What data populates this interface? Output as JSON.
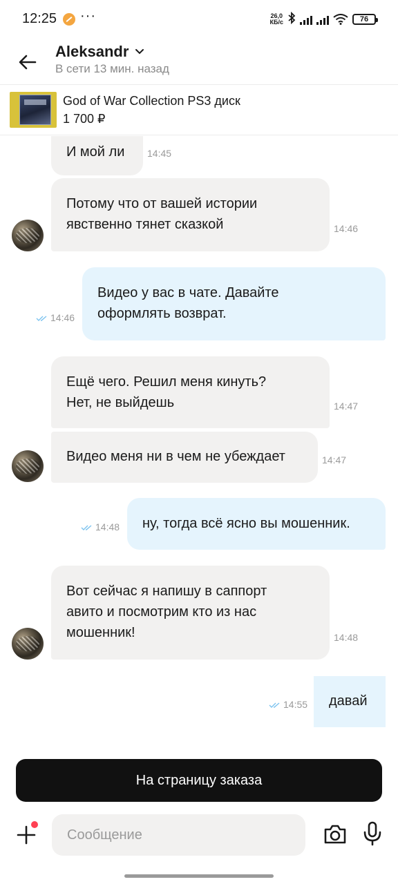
{
  "status_bar": {
    "time": "12:25",
    "dots": "···",
    "net_speed_value": "26,0",
    "net_speed_unit": "КБ/с",
    "battery": "76"
  },
  "header": {
    "contact_name": "Aleksandr",
    "contact_status": "В сети 13 мин. назад"
  },
  "listing": {
    "title": "God of War Collection PS3 диск",
    "price": "1 700 ₽"
  },
  "messages": [
    {
      "direction": "in",
      "lines": [
        "И мой ли"
      ],
      "time": "14:45"
    },
    {
      "direction": "in",
      "lines": [
        "Потому что от вашей истории",
        "явственно тянет сказкой"
      ],
      "time": "14:46"
    },
    {
      "direction": "out",
      "lines": [
        "Видео у вас в чате. Давайте",
        "оформлять возврат."
      ],
      "time": "14:46"
    },
    {
      "direction": "in",
      "lines": [
        "Ещё чего. Решил меня кинуть?",
        "Нет, не выйдешь"
      ],
      "time": "14:47"
    },
    {
      "direction": "in",
      "lines": [
        "Видео меня ни в чем не убеждает"
      ],
      "time": "14:47"
    },
    {
      "direction": "out",
      "lines": [
        "ну, тогда всё ясно вы мошенник."
      ],
      "time": "14:48"
    },
    {
      "direction": "in",
      "lines": [
        "Вот сейчас я напишу в саппорт",
        "авито и посмотрим кто из нас",
        "мошенник!"
      ],
      "time": "14:48"
    },
    {
      "direction": "out",
      "lines": [
        "давай"
      ],
      "time": "14:55"
    }
  ],
  "actions": {
    "order_button": "На страницу заказа"
  },
  "composer": {
    "placeholder": "Сообщение"
  },
  "icons": {
    "back": "arrow-left-icon",
    "chevron": "chevron-down-icon",
    "plus": "plus-icon",
    "camera": "camera-icon",
    "mic": "microphone-icon",
    "read_receipt": "double-check-icon"
  },
  "colors": {
    "incoming_bubble": "#f2f1f0",
    "outgoing_bubble": "#e5f4fd",
    "read_check": "#7cc3ef",
    "order_button": "#111111",
    "notification_dot": "#ff4053"
  }
}
